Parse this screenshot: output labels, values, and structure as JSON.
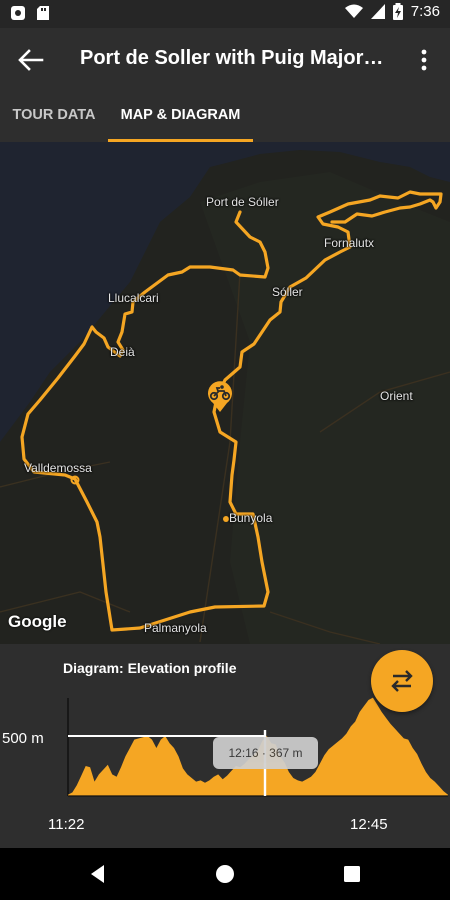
{
  "status_bar": {
    "time": "7:36",
    "battery_icon": "battery-charging-icon",
    "wifi_icon": "wifi-icon",
    "signal_icon": "cell-signal-icon"
  },
  "app_bar": {
    "title": "Port de Soller with Puig Major…",
    "back_icon": "arrow-back-icon",
    "menu_icon": "more-vert-icon"
  },
  "tabs": [
    {
      "label": "TOUR DATA"
    },
    {
      "label": "MAP & DIAGRAM",
      "active": true
    }
  ],
  "colors": {
    "accent": "#f5a623",
    "map_bg": "#22231f",
    "sea": "#1f2430",
    "route": "#f5a623",
    "panel": "#2e2e2e"
  },
  "map": {
    "labels": [
      "Port de Sóller",
      "Fornalutx",
      "Llucalcari",
      "Sóller",
      "Deià",
      "Orient",
      "Valldemossa",
      "Bunyola",
      "Palmanyola"
    ],
    "attribution": "Google",
    "marker_icon": "motorcycle-icon"
  },
  "diagram": {
    "title": "Diagram: Elevation profile",
    "y_label": "500 m",
    "x_start": "11:22",
    "x_end": "12:45",
    "readout": "12:16 · 367 m",
    "swap_icon": "swap-horizontal-icon"
  },
  "chart_data": {
    "type": "area",
    "title": "Diagram: Elevation profile",
    "xlabel": "",
    "ylabel": "",
    "x_ticks": [
      "11:22",
      "12:45"
    ],
    "y_ticks": [
      "500 m"
    ],
    "ylim": [
      0,
      850
    ],
    "cursor": {
      "time": "12:16",
      "elevation_m": 367
    },
    "series": [
      {
        "elevation_m": [
          10,
          30,
          90,
          170,
          250,
          240,
          120,
          180,
          220,
          260,
          180,
          160,
          240,
          330,
          400,
          470,
          480,
          490,
          500,
          470,
          400,
          470,
          500,
          440,
          400,
          330,
          230,
          180,
          150,
          120,
          130,
          110,
          130,
          160,
          180,
          140,
          170,
          210,
          250,
          240,
          270,
          310,
          340,
          380,
          460,
          500,
          440,
          430,
          330,
          280,
          200,
          150,
          130,
          120,
          140,
          160,
          200,
          270,
          340,
          390,
          420,
          450,
          480,
          520,
          580,
          620,
          700,
          750,
          800,
          820,
          760,
          700,
          650,
          600,
          560,
          520,
          480,
          470,
          400,
          350,
          270,
          200,
          150,
          120,
          80,
          40,
          10
        ]
      }
    ]
  },
  "nav_bar": {
    "back_icon": "nav-back-icon",
    "home_icon": "nav-home-icon",
    "recents_icon": "nav-recents-icon"
  }
}
